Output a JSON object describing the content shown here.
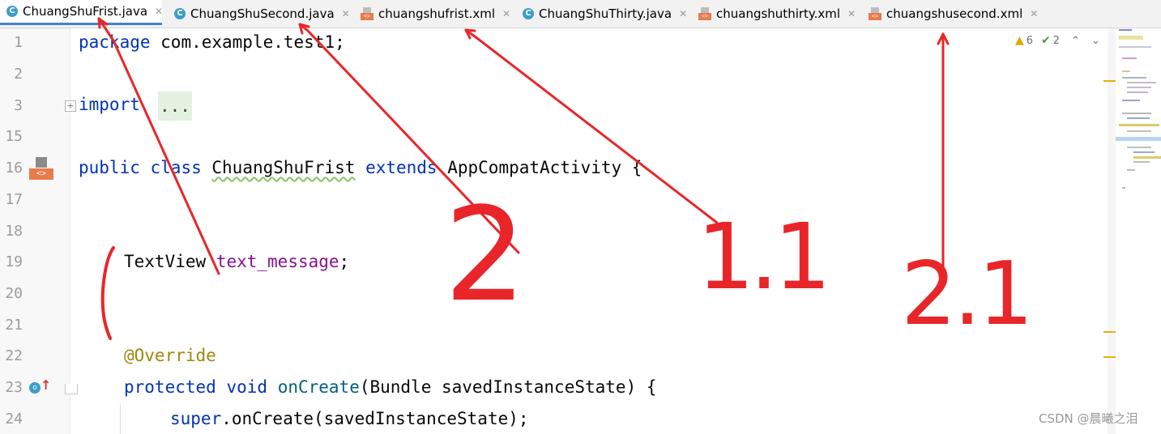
{
  "tabs": [
    {
      "label": "ChuangShuFrist.java",
      "type": "java",
      "active": true
    },
    {
      "label": "ChuangShuSecond.java",
      "type": "java",
      "active": false
    },
    {
      "label": "chuangshufrist.xml",
      "type": "xml",
      "active": false
    },
    {
      "label": "ChuangShuThirty.java",
      "type": "java",
      "active": false
    },
    {
      "label": "chuangshuthirty.xml",
      "type": "xml",
      "active": false
    },
    {
      "label": "chuangshusecond.xml",
      "type": "xml",
      "active": false
    }
  ],
  "icons": {
    "java": "java-class-icon",
    "xml": "xml-file-icon",
    "close": "close-icon"
  },
  "inspection": {
    "warnings": "6",
    "ok": "2"
  },
  "line_numbers": [
    "1",
    "2",
    "3",
    "15",
    "16",
    "17",
    "18",
    "19",
    "20",
    "21",
    "22",
    "23",
    "24"
  ],
  "code": {
    "l1_kw": "package",
    "l1_rest": " com.example.test1;",
    "l3_kw": "import",
    "l3_fold": "...",
    "l16_kw1": "public",
    "l16_kw2": "class",
    "l16_name": "ChuangShuFrist",
    "l16_kw3": "extends",
    "l16_rest": "AppCompatActivity {",
    "l19_type": "TextView",
    "l19_field": "text_message",
    "l19_end": ";",
    "l22_ann": "@Override",
    "l23_kw1": "protected",
    "l23_kw2": "void",
    "l23_fn": "onCreate",
    "l23_rest": "(Bundle savedInstanceState) {",
    "l24_kw": "super",
    "l24_rest": ".onCreate(savedInstanceState);"
  },
  "annotations": {
    "note_1": "2",
    "note_2": "1.1",
    "note_3": "2.1"
  },
  "colors": {
    "keyword": "#0033b3",
    "field": "#871094",
    "annotation": "#9e880d",
    "method": "#00627a",
    "ink": "#e8262a",
    "tab_accent": "#4083c9"
  },
  "watermark": "CSDN @晨曦之泪"
}
